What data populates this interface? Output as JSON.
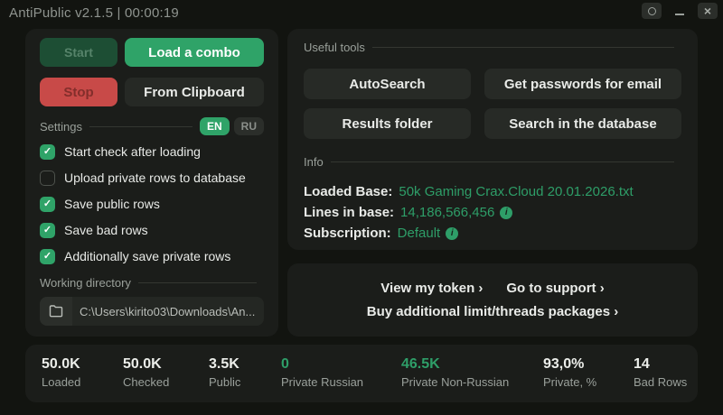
{
  "colors": {
    "accent_green": "#2fa368",
    "value_green": "#2e9e68",
    "stop_red": "#c84a48",
    "panel_bg": "#1b1d1a",
    "window_bg": "#121410"
  },
  "titlebar": {
    "title": "AntiPublic v2.1.5 | 00:00:19",
    "close_glyph": "×"
  },
  "left_panel": {
    "buttons": {
      "start": "Start",
      "load_combo": "Load a combo",
      "stop": "Stop",
      "from_clipboard": "From Clipboard"
    },
    "settings": {
      "label": "Settings",
      "lang_en": "EN",
      "lang_ru": "RU",
      "checkboxes": [
        {
          "label": "Start check after loading",
          "checked": true
        },
        {
          "label": "Upload private rows to database",
          "checked": false
        },
        {
          "label": "Save public rows",
          "checked": true
        },
        {
          "label": "Save bad rows",
          "checked": true
        },
        {
          "label": "Additionally save private rows",
          "checked": true
        }
      ]
    },
    "working_directory": {
      "label": "Working directory",
      "path": "C:\\Users\\kirito03\\Downloads\\An..."
    }
  },
  "tools_panel": {
    "label": "Useful tools",
    "buttons": [
      {
        "label": "AutoSearch"
      },
      {
        "label": "Get passwords for email"
      },
      {
        "label": "Results folder"
      },
      {
        "label": "Search in the database"
      }
    ]
  },
  "info_panel": {
    "label": "Info",
    "rows": [
      {
        "label": "Loaded Base:",
        "value": "50k Gaming Crax.Cloud 20.01.2026.txt",
        "info": false
      },
      {
        "label": "Lines in base:",
        "value": "14,186,566,456",
        "info": true
      },
      {
        "label": "Subscription:",
        "value": "Default",
        "info": true
      }
    ],
    "info_icon_glyph": "i"
  },
  "links_panel": {
    "links": [
      {
        "label": "View my token ›"
      },
      {
        "label": "Go to support ›"
      },
      {
        "label": "Buy additional limit/threads packages ›"
      }
    ]
  },
  "stats": [
    {
      "value": "50.0K",
      "label": "Loaded",
      "green": false
    },
    {
      "value": "50.0K",
      "label": "Checked",
      "green": false
    },
    {
      "value": "3.5K",
      "label": "Public",
      "green": false
    },
    {
      "value": "0",
      "label": "Private Russian",
      "green": true
    },
    {
      "value": "46.5K",
      "label": "Private Non-Russian",
      "green": true
    },
    {
      "value": "93,0%",
      "label": "Private, %",
      "green": false
    },
    {
      "value": "14",
      "label": "Bad Rows",
      "green": false
    }
  ]
}
